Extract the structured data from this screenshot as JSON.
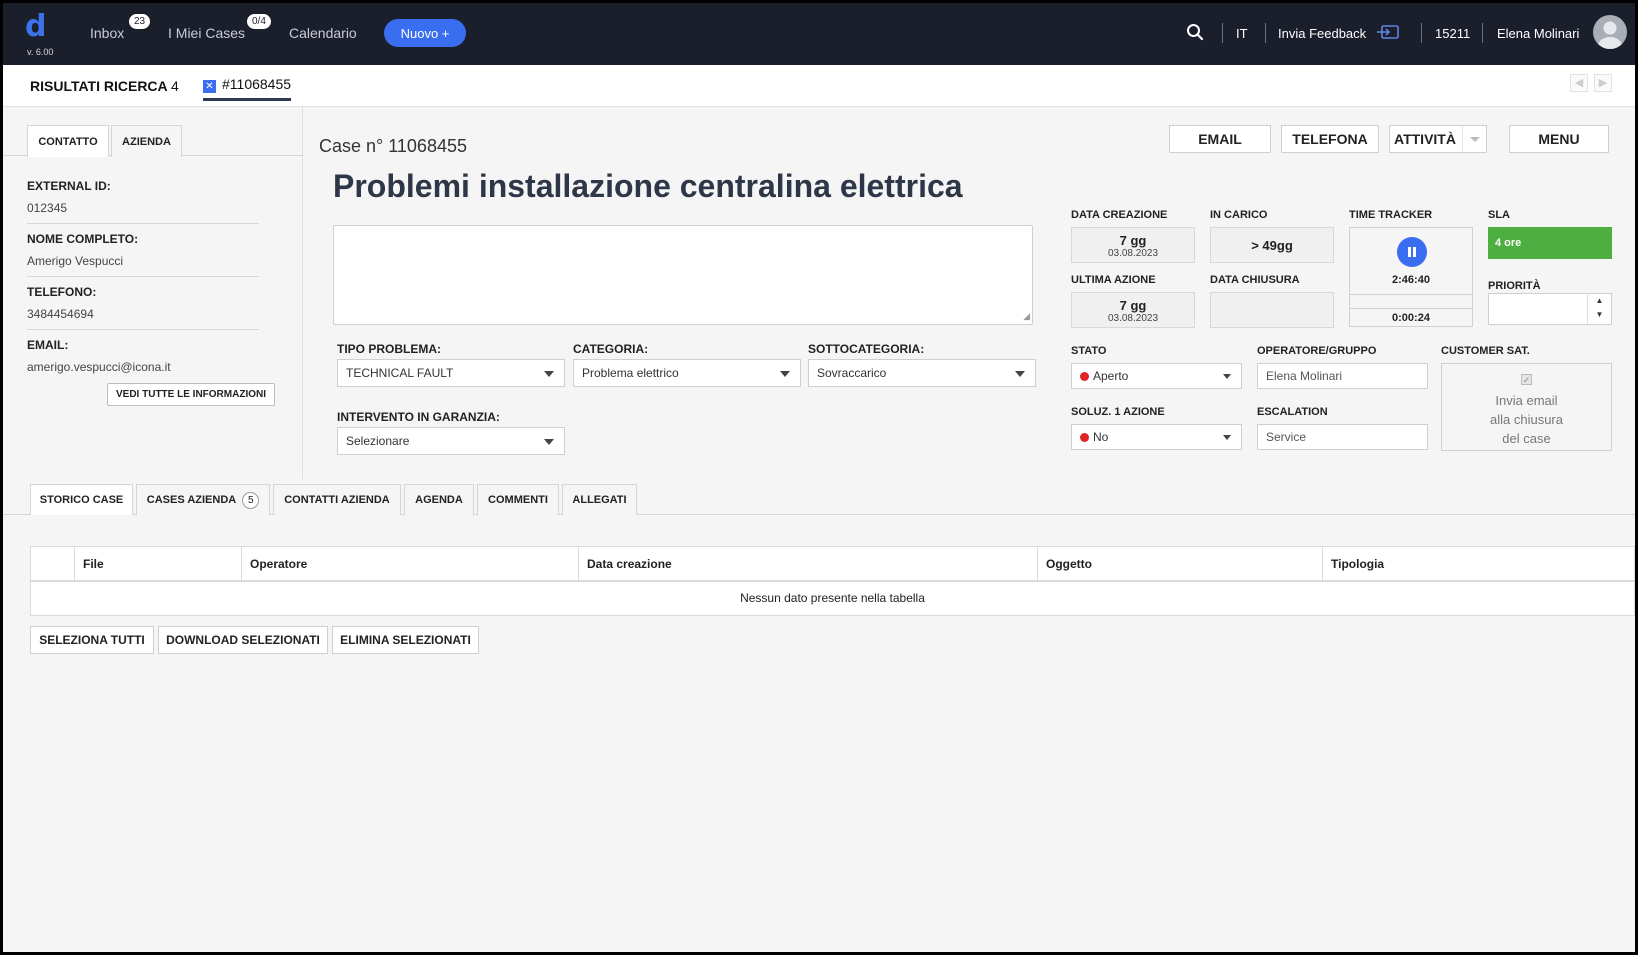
{
  "app": {
    "logo": "d",
    "version": "v. 6.00"
  },
  "nav": {
    "inbox": {
      "label": "Inbox",
      "badge": "23"
    },
    "my_cases": {
      "label": "I Miei Cases",
      "badge": "0/4"
    },
    "calendar": "Calendario",
    "new_button": "Nuovo +"
  },
  "topright": {
    "language": "IT",
    "feedback": "Invia Feedback",
    "user_id": "15211",
    "user_name": "Elena Molinari"
  },
  "subbar": {
    "results_label": "RISULTATI RICERCA",
    "results_count": "4",
    "case_tab": "#11068455",
    "case_tab_close": "✕"
  },
  "left_tabs": [
    "CONTATTO",
    "AZIENDA"
  ],
  "contact": {
    "external_id_label": "EXTERNAL ID:",
    "external_id": "012345",
    "name_label": "NOME COMPLETO:",
    "name": "Amerigo Vespucci",
    "phone_label": "TELEFONO:",
    "phone": "3484454694",
    "email_label": "EMAIL:",
    "email": "amerigo.vespucci@icona.it",
    "info_button": "VEDI TUTTE LE INFORMAZIONI"
  },
  "case": {
    "number": "Case n° 11068455",
    "title": "Problemi installazione centralina elettrica",
    "description": ""
  },
  "actions": {
    "email": "EMAIL",
    "phone": "TELEFONA",
    "activity": "ATTIVITÀ",
    "menu": "MENU"
  },
  "form": {
    "problem_type_label": "TIPO PROBLEMA:",
    "problem_type": "TECHNICAL FAULT",
    "category_label": "CATEGORIA:",
    "category": "Problema elettrico",
    "subcategory_label": "SOTTOCATEGORIA:",
    "subcategory": "Sovraccarico",
    "warranty_label": "INTERVENTO IN GARANZIA:",
    "warranty": "Selezionare"
  },
  "meta": {
    "created_label": "DATA CREAZIONE",
    "created_days": "7 gg",
    "created_date": "03.08.2023",
    "assigned_label": "IN CARICO",
    "assigned_value": "> 49gg",
    "tracker_label": "TIME TRACKER",
    "tracker_total": "2:46:40",
    "tracker_current": "0:00:24",
    "sla_label": "SLA",
    "sla_value": "4 ore",
    "last_action_label": "ULTIMA AZIONE",
    "last_action_days": "7 gg",
    "last_action_date": "03.08.2023",
    "closed_label": "DATA CHIUSURA",
    "closed_value": "",
    "priority_label": "PRIORITÀ",
    "priority_value": "",
    "status_label": "STATO",
    "status_value": "Aperto",
    "operator_label": "OPERATORE/GRUPPO",
    "operator_value": "Elena Molinari",
    "csat_label": "CUSTOMER SAT.",
    "csat_line1": "Invia email",
    "csat_line2": "alla chiusura",
    "csat_line3": "del case",
    "first_solution_label": "SOLUZ. 1 AZIONE",
    "first_solution_value": "No",
    "escalation_label": "ESCALATION",
    "escalation_value": "Service",
    "status_color": "#e02424",
    "sla_color": "#4caf3f"
  },
  "bottom_tabs": {
    "history": "STORICO CASE",
    "company_cases": "CASES AZIENDA",
    "company_cases_count": "5",
    "company_contacts": "CONTATTI AZIENDA",
    "agenda": "AGENDA",
    "comments": "COMMENTI",
    "attachments": "ALLEGATI"
  },
  "table": {
    "columns": [
      "",
      "File",
      "Operatore",
      "Data creazione",
      "Oggetto",
      "Tipologia"
    ],
    "empty_message": "Nessun dato presente nella tabella"
  },
  "table_actions": {
    "select_all": "SELEZIONA TUTTI",
    "download": "DOWNLOAD SELEZIONATI",
    "delete": "ELIMINA SELEZIONATI"
  }
}
